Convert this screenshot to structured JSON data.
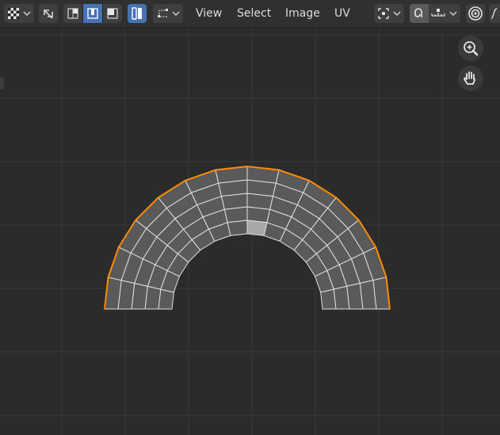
{
  "header": {
    "editor_type_icon": "checker-uv-icon",
    "sync_selection_icon": "sync-arrows-icon",
    "select_modes": [
      "vertex-select-icon",
      "edge-select-icon",
      "face-select-icon"
    ],
    "island_select_icon": "island-select-icon",
    "sticky_select_icon": "sticky-selection-icon",
    "menus": [
      "View",
      "Select",
      "Image",
      "UV"
    ],
    "pivot_icon": "pivot-point-icon",
    "snap_icon": "snap-magnet-icon",
    "snap_target_icon": "snap-increment-icon",
    "proportional_icon": "proportional-edit-icon",
    "falloff_icon": "falloff-curve-icon"
  },
  "viewport": {
    "background": "#2b2b2b",
    "grid_color": "#3a3a3a",
    "mesh_face_color": "#5a5a5a",
    "mesh_edge_color": "#e0e0e0",
    "boundary_color": "#ff8c00",
    "active_face_color": "#a8a8a8",
    "nav_buttons": [
      "zoom-icon",
      "hand-pan-icon"
    ]
  }
}
